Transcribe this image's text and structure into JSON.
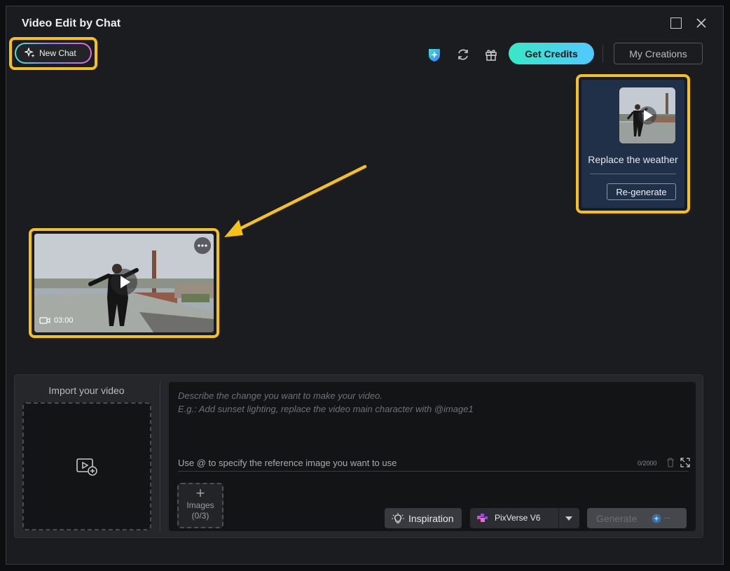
{
  "window": {
    "title": "Video Edit by Chat"
  },
  "toolbar": {
    "new_chat_label": "New Chat",
    "get_credits_label": "Get Credits",
    "my_creations_label": "My Creations",
    "icons": [
      "shield-sparkle-icon",
      "refresh-icon",
      "gift-icon"
    ]
  },
  "chat": {
    "user_message": {
      "text": "Replace the weather",
      "regenerate_label": "Re-generate"
    },
    "result_video": {
      "duration": "03:00"
    }
  },
  "composer": {
    "import_label": "Import your video",
    "placeholder_line1": "Describe the change you want to make your video.",
    "placeholder_line2": "E.g.: Add sunset lighting, replace the video main character with @image1",
    "hint": "Use @ to specify the reference image you want to use",
    "char_counter": "0/2000",
    "images_label": "Images",
    "images_count": "(0/3)",
    "inspiration_label": "Inspiration",
    "model_name": "PixVerse V6",
    "generate_label": "Generate",
    "generate_cost": "--"
  },
  "colors": {
    "highlight": "#f6c21a",
    "accent_gradient_start": "#38e8c7",
    "accent_gradient_end": "#52c8ff",
    "message_bg": "#203049"
  }
}
